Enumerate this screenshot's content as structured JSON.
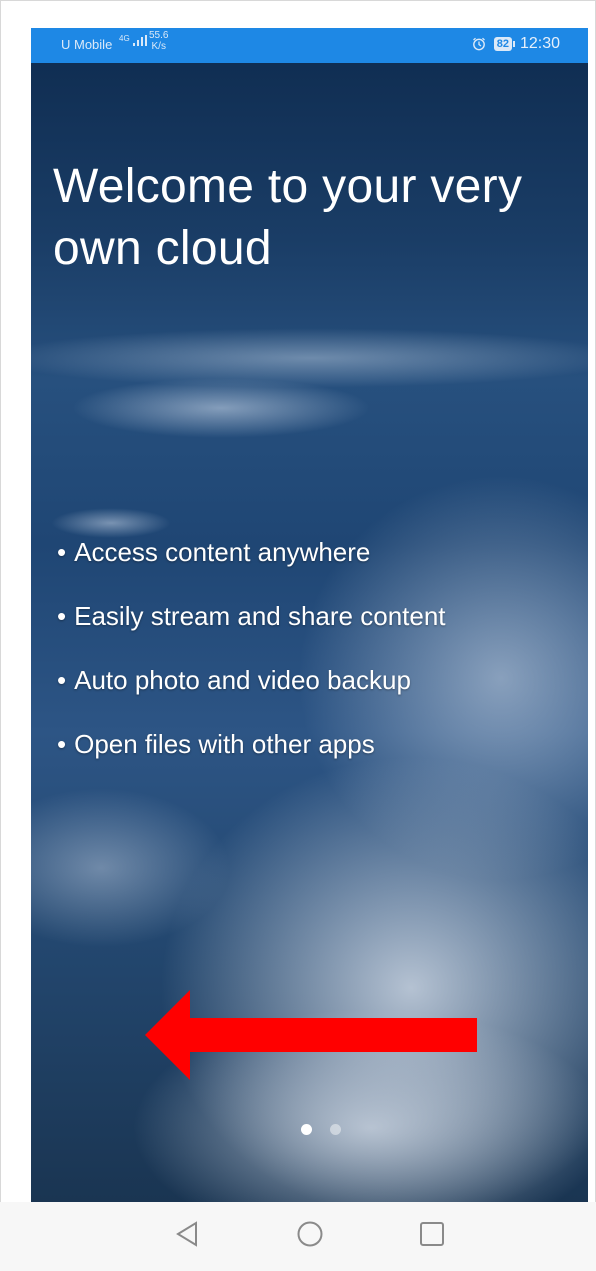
{
  "status_bar": {
    "carrier": "U Mobile",
    "network": "4G",
    "speed_value": "55.6",
    "speed_unit": "K/s",
    "battery": "82",
    "time": "12:30"
  },
  "welcome": {
    "title_line1": "Welcome to your very",
    "title_line2": "own cloud"
  },
  "features": [
    "Access content anywhere",
    "Easily stream and share content",
    "Auto photo and video backup",
    "Open files with other apps"
  ],
  "pager": {
    "total_pages": 2,
    "current_page": 1
  },
  "colors": {
    "status_bar_bg": "#1e88e5",
    "annotation_arrow": "#ff0000",
    "navbar_bg": "#f7f7f7"
  },
  "icons": {
    "annotation": "arrow-left-icon",
    "alarm": "alarm-icon",
    "nav_back": "back-triangle-icon",
    "nav_home": "home-circle-icon",
    "nav_recent": "recent-square-icon"
  }
}
